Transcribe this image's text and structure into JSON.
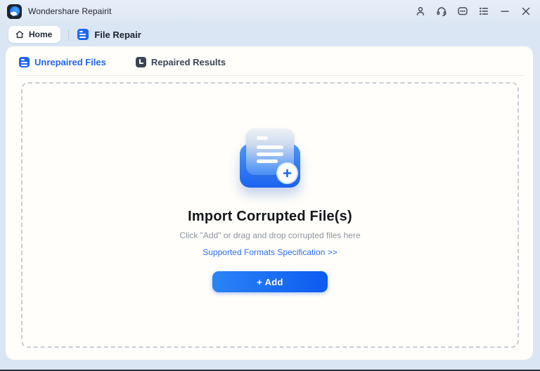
{
  "titlebar": {
    "app_name": "Wondershare Repairit"
  },
  "nav": {
    "home": "Home",
    "file_repair": "File Repair"
  },
  "subtabs": {
    "unrepaired": "Unrepaired Files",
    "repaired": "Repaired Results"
  },
  "dropzone": {
    "title": "Import Corrupted File(s)",
    "hint": "Click \"Add\" or drag and drop corrupted files here",
    "formats_link": "Supported Formats Specification >>",
    "add_button": "+ Add"
  },
  "colors": {
    "accent_blue": "#2066f0",
    "link_blue": "#2f6df3",
    "button_gradient_start": "#2b84f7",
    "button_gradient_end": "#0d5af0",
    "window_background": "#dbe6f4",
    "panel_background": "#fffefa",
    "subtab_inactive": "#3c4655"
  }
}
